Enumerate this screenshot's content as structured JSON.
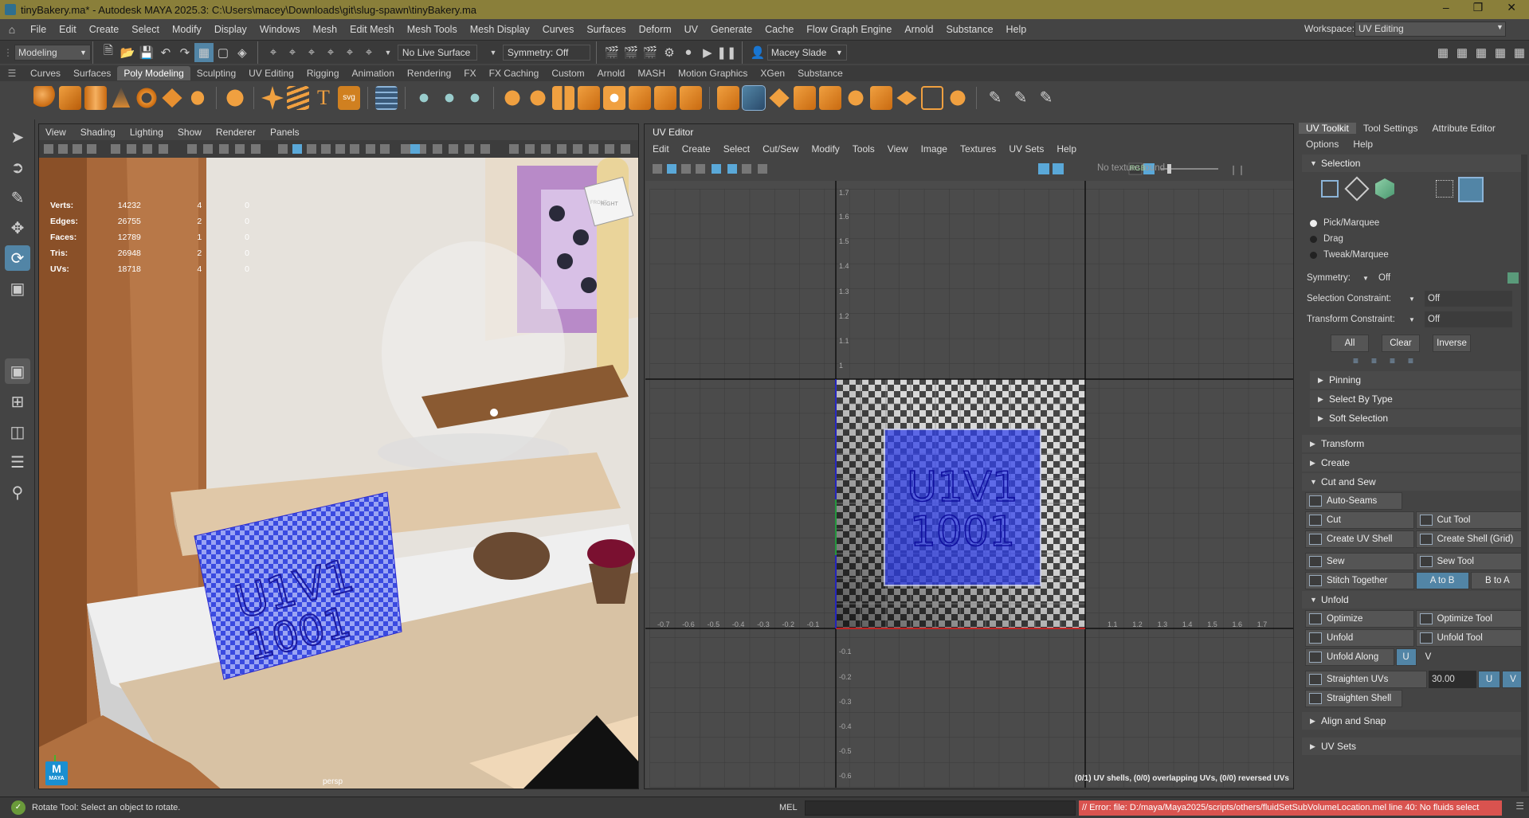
{
  "titlebar": {
    "title": "tinyBakery.ma* - Autodesk MAYA 2025.3: C:\\Users\\macey\\Downloads\\git\\slug-spawn\\tinyBakery.ma"
  },
  "menubar": {
    "items": [
      "File",
      "Edit",
      "Create",
      "Select",
      "Modify",
      "Display",
      "Windows",
      "Mesh",
      "Edit Mesh",
      "Mesh Tools",
      "Mesh Display",
      "Curves",
      "Surfaces",
      "Deform",
      "UV",
      "Generate",
      "Cache",
      "Flow Graph Engine",
      "Arnold",
      "Substance",
      "Help"
    ],
    "workspace_label": "Workspace:",
    "workspace_value": "UV Editing"
  },
  "statusline": {
    "menuset": "Modeling",
    "live_surface": "No Live Surface",
    "symmetry": "Symmetry: Off",
    "user": "Macey Slade"
  },
  "shelf": {
    "tabs": [
      "Curves",
      "Surfaces",
      "Poly Modeling",
      "Sculpting",
      "UV Editing",
      "Rigging",
      "Animation",
      "Rendering",
      "FX",
      "FX Caching",
      "Custom",
      "Arnold",
      "MASH",
      "Motion Graphics",
      "XGen",
      "Substance"
    ],
    "active": "Poly Modeling",
    "svg_label": "svg"
  },
  "viewport": {
    "menu": [
      "View",
      "Shading",
      "Lighting",
      "Show",
      "Renderer",
      "Panels"
    ],
    "hud": [
      {
        "k": "Verts:",
        "v": "14232",
        "a": "4",
        "b": "0"
      },
      {
        "k": "Edges:",
        "v": "26755",
        "a": "2",
        "b": "0"
      },
      {
        "k": "Faces:",
        "v": "12789",
        "a": "1",
        "b": "0"
      },
      {
        "k": "Tris:",
        "v": "26948",
        "a": "2",
        "b": "0"
      },
      {
        "k": "UVs:",
        "v": "18718",
        "a": "4",
        "b": "0"
      }
    ],
    "camera": "persp",
    "viewcube_front": "FRONT",
    "viewcube_right": "RIGHT",
    "sign_line1": "U1V1",
    "sign_line2": "1001",
    "maya_badge": "M",
    "maya_badge_sub": "MAYA"
  },
  "uv_editor": {
    "title": "UV Editor",
    "menu": [
      "Edit",
      "Create",
      "Select",
      "Cut/Sew",
      "Modify",
      "Tools",
      "View",
      "Image",
      "Textures",
      "UV Sets",
      "Help"
    ],
    "no_texture": "No texture found",
    "rgb_label": "RGB",
    "y_ticks": [
      "1.7",
      "1.6",
      "1.5",
      "1.4",
      "1.3",
      "1.2",
      "1.1",
      "1",
      "-0.1",
      "-0.2",
      "-0.3",
      "-0.4",
      "-0.5",
      "-0.6"
    ],
    "x_ticks_neg": [
      "-0.7",
      "-0.6",
      "-0.5",
      "-0.4",
      "-0.3",
      "-0.2",
      "-0.1"
    ],
    "x_ticks_pos": [
      "1.1",
      "1.2",
      "1.3",
      "1.4",
      "1.5",
      "1.6",
      "1.7"
    ],
    "tile_line1": "U1V1",
    "tile_line2": "1001",
    "status": "(0/1) UV shells, (0/0) overlapping UVs, (0/0) reversed UVs"
  },
  "right_panel": {
    "tabs": [
      "UV Toolkit",
      "Tool Settings",
      "Attribute Editor"
    ],
    "menu": [
      "Options",
      "Help"
    ],
    "selection": "Selection",
    "radios": [
      "Pick/Marquee",
      "Drag",
      "Tweak/Marquee"
    ],
    "symmetry_label": "Symmetry:",
    "symmetry_value": "Off",
    "sel_constraint_label": "Selection Constraint:",
    "sel_constraint_value": "Off",
    "xform_constraint_label": "Transform Constraint:",
    "xform_constraint_value": "Off",
    "all": "All",
    "clear": "Clear",
    "inverse": "Inverse",
    "sub_sections": [
      "Pinning",
      "Select By Type",
      "Soft Selection"
    ],
    "transform": "Transform",
    "create": "Create",
    "cut_and_sew": "Cut and Sew",
    "auto_seams": "Auto-Seams",
    "cut": "Cut",
    "cut_tool": "Cut Tool",
    "create_uv_shell": "Create UV Shell",
    "create_shell_grid": "Create Shell (Grid)",
    "sew": "Sew",
    "sew_tool": "Sew Tool",
    "stitch_together": "Stitch Together",
    "a_to_b": "A to B",
    "b_to_a": "B to A",
    "unfold_section": "Unfold",
    "optimize": "Optimize",
    "optimize_tool": "Optimize Tool",
    "unfold": "Unfold",
    "unfold_tool": "Unfold Tool",
    "unfold_along": "Unfold Along",
    "u": "U",
    "v": "V",
    "straighten_uvs": "Straighten UVs",
    "straighten_value": "30.00",
    "straighten_shell": "Straighten Shell",
    "align_and_snap": "Align and Snap",
    "uv_sets": "UV Sets"
  },
  "bottom": {
    "help": "Rotate Tool: Select an object to rotate.",
    "mel": "MEL",
    "error": "// Error: file: D:/maya/Maya2025/scripts/others/fluidSetSubVolumeLocation.mel line 40: No fluids select"
  },
  "colors": {
    "accent": "#5285a6",
    "title_bar": "#8a7f3a",
    "error": "#d9534f",
    "uv_blue": "#3344dd"
  }
}
